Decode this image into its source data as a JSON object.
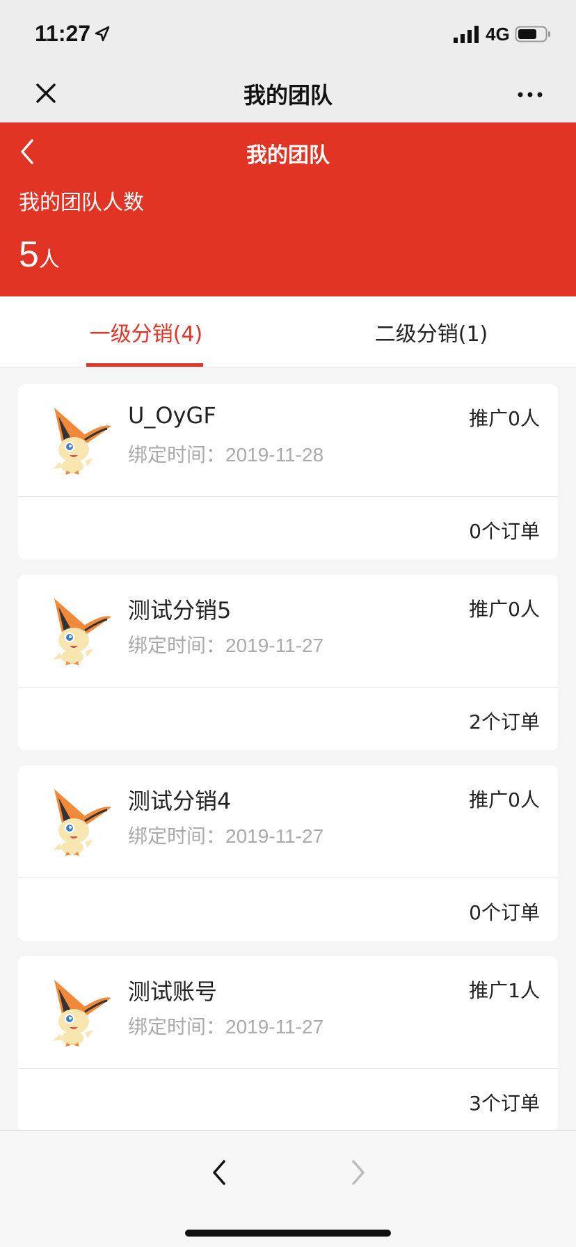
{
  "status": {
    "time": "11:27",
    "network": "4G"
  },
  "wx": {
    "title": "我的团队"
  },
  "header": {
    "title": "我的团队",
    "team_label": "我的团队人数",
    "count": "5",
    "unit": "人"
  },
  "tabs": [
    {
      "label": "一级分销(4)",
      "active": true
    },
    {
      "label": "二级分销(1)",
      "active": false
    }
  ],
  "members": [
    {
      "name": "U_OyGF",
      "bind_label": "绑定时间：",
      "date": "2019-11-28",
      "promote": "推广0人",
      "orders": "0个订单"
    },
    {
      "name": "测试分销5",
      "bind_label": "绑定时间：",
      "date": "2019-11-27",
      "promote": "推广0人",
      "orders": "2个订单"
    },
    {
      "name": "测试分销4",
      "bind_label": "绑定时间：",
      "date": "2019-11-27",
      "promote": "推广0人",
      "orders": "0个订单"
    },
    {
      "name": "测试账号",
      "bind_label": "绑定时间：",
      "date": "2019-11-27",
      "promote": "推广1人",
      "orders": "3个订单"
    }
  ],
  "colors": {
    "accent": "#e23424",
    "muted": "#aaaaaa"
  },
  "icons": {
    "close": "close-icon",
    "more": "more-dots-icon",
    "back": "chevron-left-icon",
    "avatar": "avatar-image",
    "nav_back": "nav-back-icon",
    "nav_forward": "nav-forward-icon"
  }
}
